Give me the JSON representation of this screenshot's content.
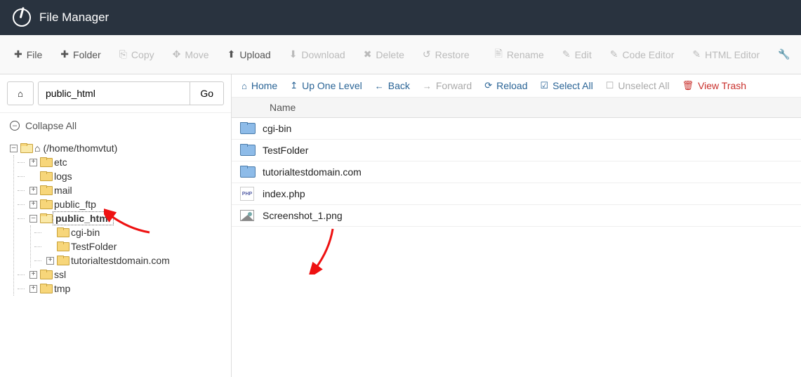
{
  "header": {
    "title": "File Manager"
  },
  "toolbar": {
    "file": "File",
    "folder": "Folder",
    "copy": "Copy",
    "move": "Move",
    "upload": "Upload",
    "download": "Download",
    "delete": "Delete",
    "restore": "Restore",
    "rename": "Rename",
    "edit": "Edit",
    "code_editor": "Code Editor",
    "html_editor": "HTML Editor"
  },
  "pathbar": {
    "value": "public_html",
    "go": "Go"
  },
  "collapse_all": "Collapse All",
  "tree": {
    "root_label": "(/home/thomvtut)",
    "items": [
      "etc",
      "logs",
      "mail",
      "public_ftp",
      "public_html",
      "ssl",
      "tmp"
    ],
    "public_html_children": [
      "cgi-bin",
      "TestFolder",
      "tutorialtestdomain.com"
    ]
  },
  "actions": {
    "home": "Home",
    "up": "Up One Level",
    "back": "Back",
    "forward": "Forward",
    "reload": "Reload",
    "select_all": "Select All",
    "unselect_all": "Unselect All",
    "view_trash": "View Trash"
  },
  "table": {
    "head_name": "Name",
    "rows": [
      {
        "name": "cgi-bin",
        "type": "folder"
      },
      {
        "name": "TestFolder",
        "type": "folder"
      },
      {
        "name": "tutorialtestdomain.com",
        "type": "folder"
      },
      {
        "name": "index.php",
        "type": "php"
      },
      {
        "name": "Screenshot_1.png",
        "type": "image"
      }
    ]
  }
}
